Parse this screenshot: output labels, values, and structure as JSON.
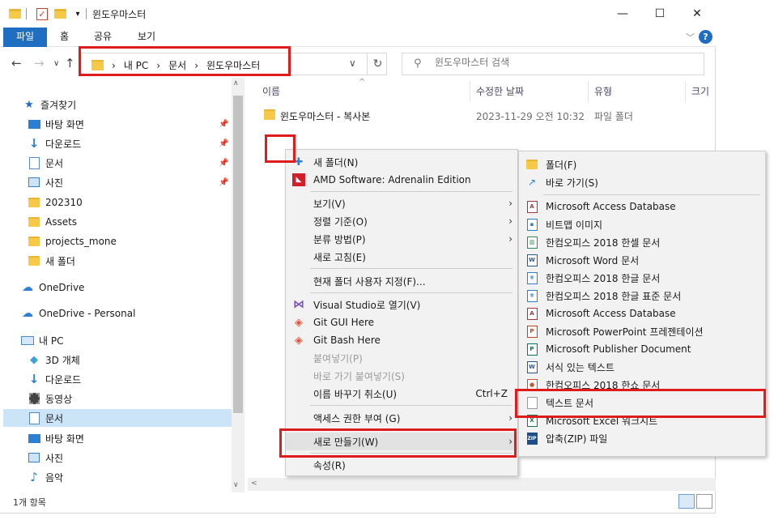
{
  "window": {
    "title": "윈도우마스터",
    "controls": {
      "minimize": "—",
      "maximize": "☐",
      "close": "✕"
    }
  },
  "ribbon": {
    "tabs": [
      "파일",
      "홈",
      "공유",
      "보기"
    ],
    "help": "?"
  },
  "address": {
    "crumbs": [
      "내 PC",
      "문서",
      "윈도우마스터"
    ],
    "separator": "›"
  },
  "search": {
    "placeholder": "윈도우마스터 검색"
  },
  "columns": {
    "name": "이름",
    "modified": "수정한 날짜",
    "type": "유형",
    "size": "크기"
  },
  "files": [
    {
      "name": "윈도우마스터 - 복사본",
      "modified": "2023-11-29 오전 10:32",
      "type": "파일 폴더"
    }
  ],
  "sidebar": {
    "quick_access": "즐겨찾기",
    "items": [
      {
        "label": "바탕 화면",
        "icon": "desktop-icon",
        "pinned": true
      },
      {
        "label": "다운로드",
        "icon": "download-icon",
        "pinned": true
      },
      {
        "label": "문서",
        "icon": "document-icon",
        "pinned": true
      },
      {
        "label": "사진",
        "icon": "picture-icon",
        "pinned": true
      },
      {
        "label": "202310",
        "icon": "folder-icon"
      },
      {
        "label": "Assets",
        "icon": "folder-icon"
      },
      {
        "label": "projects_mone",
        "icon": "folder-icon"
      },
      {
        "label": "새 폴더",
        "icon": "folder-icon"
      }
    ],
    "onedrive": "OneDrive",
    "onedrive_personal": "OneDrive - Personal",
    "this_pc": "내 PC",
    "pc_items": [
      {
        "label": "3D 개체",
        "icon": "cube-icon"
      },
      {
        "label": "다운로드",
        "icon": "download-icon"
      },
      {
        "label": "동영상",
        "icon": "video-icon"
      },
      {
        "label": "문서",
        "icon": "document-icon",
        "selected": true
      },
      {
        "label": "바탕 화면",
        "icon": "desktop-icon"
      },
      {
        "label": "사진",
        "icon": "picture-icon"
      },
      {
        "label": "음악",
        "icon": "music-icon"
      }
    ]
  },
  "status": {
    "count": "1개 항목"
  },
  "context_menu": {
    "items": [
      {
        "label": "새 폴더(N)",
        "icon": "new-folder-icon"
      },
      {
        "label": "AMD Software: Adrenalin Edition",
        "icon": "amd-icon"
      },
      {
        "label": "보기(V)",
        "submenu": true
      },
      {
        "label": "정렬 기준(O)",
        "submenu": true
      },
      {
        "label": "분류 방법(P)",
        "submenu": true
      },
      {
        "label": "새로 고침(E)"
      },
      {
        "label": "현재 폴더 사용자 지정(F)..."
      },
      {
        "label": "Visual Studio로 열기(V)",
        "icon": "visual-studio-icon"
      },
      {
        "label": "Git GUI Here",
        "icon": "git-icon"
      },
      {
        "label": "Git Bash Here",
        "icon": "git-icon"
      },
      {
        "label": "붙여넣기(P)",
        "disabled": true
      },
      {
        "label": "바로 가기 붙여넣기(S)",
        "disabled": true
      },
      {
        "label": "이름 바꾸기 취소(U)",
        "shortcut": "Ctrl+Z"
      },
      {
        "label": "액세스 권한 부여 (G)",
        "submenu": true
      },
      {
        "label": "새로 만들기(W)",
        "submenu": true
      },
      {
        "label": "속성(R)"
      }
    ]
  },
  "new_submenu": {
    "items": [
      {
        "label": "폴더(F)",
        "icon": "folder-icon"
      },
      {
        "label": "바로 가기(S)",
        "icon": "shortcut-icon"
      },
      {
        "label": "Microsoft Access Database",
        "icon": "access-icon"
      },
      {
        "label": "비트맵 이미지",
        "icon": "bitmap-icon"
      },
      {
        "label": "한컴오피스 2018 한셀 문서",
        "icon": "hancell-icon"
      },
      {
        "label": "Microsoft Word 문서",
        "icon": "word-icon"
      },
      {
        "label": "한컴오피스 2018 한글 문서",
        "icon": "hwp-icon"
      },
      {
        "label": "한컴오피스 2018 한글 표준 문서",
        "icon": "hwp-icon"
      },
      {
        "label": "Microsoft Access Database",
        "icon": "access-icon"
      },
      {
        "label": "Microsoft PowerPoint 프레젠테이션",
        "icon": "powerpoint-icon"
      },
      {
        "label": "Microsoft Publisher Document",
        "icon": "publisher-icon"
      },
      {
        "label": "서식 있는 텍스트",
        "icon": "rtf-icon"
      },
      {
        "label": "한컴오피스 2018 한쇼 문서",
        "icon": "hanshow-icon"
      },
      {
        "label": "텍스트 문서",
        "icon": "text-file-icon"
      },
      {
        "label": "Microsoft Excel 워크시트",
        "icon": "excel-icon"
      },
      {
        "label": "압축(ZIP) 파일",
        "icon": "zip-icon"
      }
    ]
  },
  "colors": {
    "accent": "#1f6ec2",
    "highlight": "#e01b1b",
    "selected": "#cce4f7"
  }
}
